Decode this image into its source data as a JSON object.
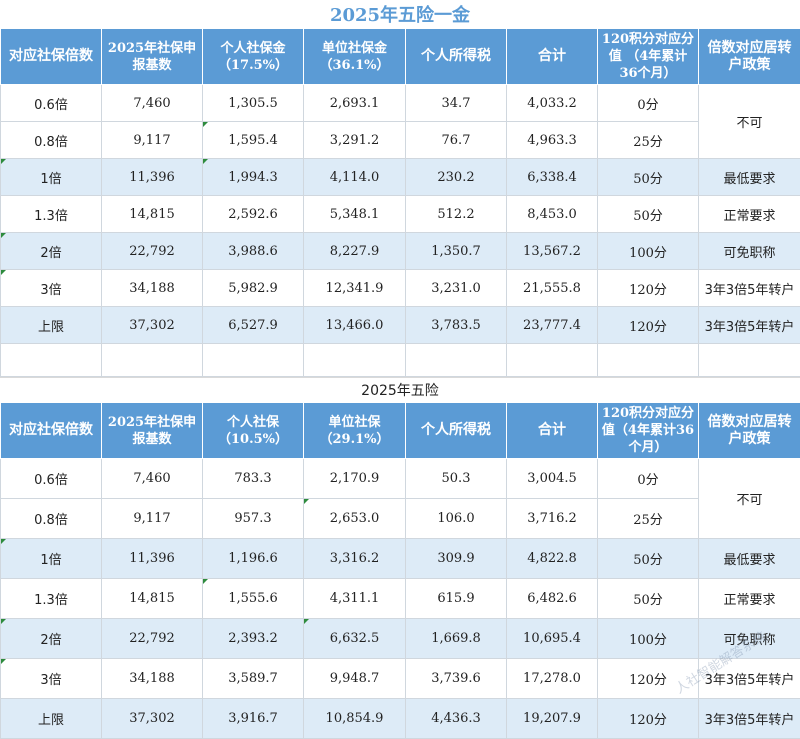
{
  "title1": "2025年五险一金",
  "title2": "2025年五险",
  "watermark": "人社智能解答系统",
  "table1": {
    "headers": [
      "对应社保倍数",
      "2025年社保申报基数",
      "个人社保金（17.5%）",
      "单位社保金（36.1%）",
      "个人所得税",
      "合计",
      "120积分对应分值 （4年累计36个月）",
      "倍数对应居转户政策"
    ],
    "rows": [
      [
        "0.6倍",
        "7,460",
        "1,305.5",
        "2,693.1",
        "34.7",
        "4,033.2",
        "0分"
      ],
      [
        "0.8倍",
        "9,117",
        "1,595.4",
        "3,291.2",
        "76.7",
        "4,963.3",
        "25分"
      ],
      [
        "1倍",
        "11,396",
        "1,994.3",
        "4,114.0",
        "230.2",
        "6,338.4",
        "50分"
      ],
      [
        "1.3倍",
        "14,815",
        "2,592.6",
        "5,348.1",
        "512.2",
        "8,453.0",
        "50分"
      ],
      [
        "2倍",
        "22,792",
        "3,988.6",
        "8,227.9",
        "1,350.7",
        "13,567.2",
        "100分"
      ],
      [
        "3倍",
        "34,188",
        "5,982.9",
        "12,341.9",
        "3,231.0",
        "21,555.8",
        "120分"
      ],
      [
        "上限",
        "37,302",
        "6,527.9",
        "13,466.0",
        "3,783.5",
        "23,777.4",
        "120分"
      ]
    ],
    "policy": [
      "不可",
      "最低要求",
      "正常要求",
      "可免职称",
      "3年3倍5年转户",
      "3年3倍5年转户"
    ]
  },
  "table2": {
    "headers": [
      "对应社保倍数",
      "2025年社保申报基数",
      "个人社保（10.5%）",
      "单位社保（29.1%）",
      "个人所得税",
      "合计",
      "120积分对应分值（4年累计36个月）",
      "倍数对应居转户政策"
    ],
    "rows": [
      [
        "0.6倍",
        "7,460",
        "783.3",
        "2,170.9",
        "50.3",
        "3,004.5",
        "0分"
      ],
      [
        "0.8倍",
        "9,117",
        "957.3",
        "2,653.0",
        "106.0",
        "3,716.2",
        "25分"
      ],
      [
        "1倍",
        "11,396",
        "1,196.6",
        "3,316.2",
        "309.9",
        "4,822.8",
        "50分"
      ],
      [
        "1.3倍",
        "14,815",
        "1,555.6",
        "4,311.1",
        "615.9",
        "6,482.6",
        "50分"
      ],
      [
        "2倍",
        "22,792",
        "2,393.2",
        "6,632.5",
        "1,669.8",
        "10,695.4",
        "100分"
      ],
      [
        "3倍",
        "34,188",
        "3,589.7",
        "9,948.7",
        "3,739.6",
        "17,278.0",
        "120分"
      ],
      [
        "上限",
        "37,302",
        "3,916.7",
        "10,854.9",
        "4,436.3",
        "19,207.9",
        "120分"
      ]
    ],
    "policy": [
      "不可",
      "最低要求",
      "正常要求",
      "可免职称",
      "3年3倍5年转户",
      "3年3倍5年转户"
    ]
  }
}
